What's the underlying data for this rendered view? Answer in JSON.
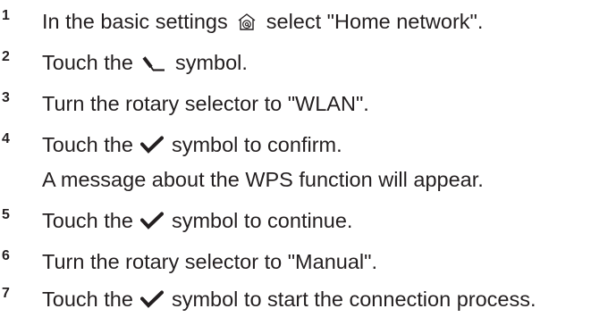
{
  "steps": [
    {
      "number": "1",
      "before": "In the basic settings",
      "icon": "home-settings-icon",
      "after": "select \"Home network\"."
    },
    {
      "number": "2",
      "before": "Touch the",
      "icon": "edit-pencil-icon",
      "after": "symbol."
    },
    {
      "number": "3",
      "text": "Turn the rotary selector to \"WLAN\"."
    },
    {
      "number": "4",
      "before": "Touch the",
      "icon": "checkmark-icon",
      "after": "symbol to confirm.",
      "line2": "A message about the WPS function will appear."
    },
    {
      "number": "5",
      "before": "Touch the",
      "icon": "checkmark-icon",
      "after": "symbol to continue."
    },
    {
      "number": "6",
      "text": "Turn the rotary selector to \"Manual\"."
    },
    {
      "number": "7",
      "before": "Touch the",
      "icon": "checkmark-icon",
      "after": "symbol to start the connection process."
    }
  ]
}
